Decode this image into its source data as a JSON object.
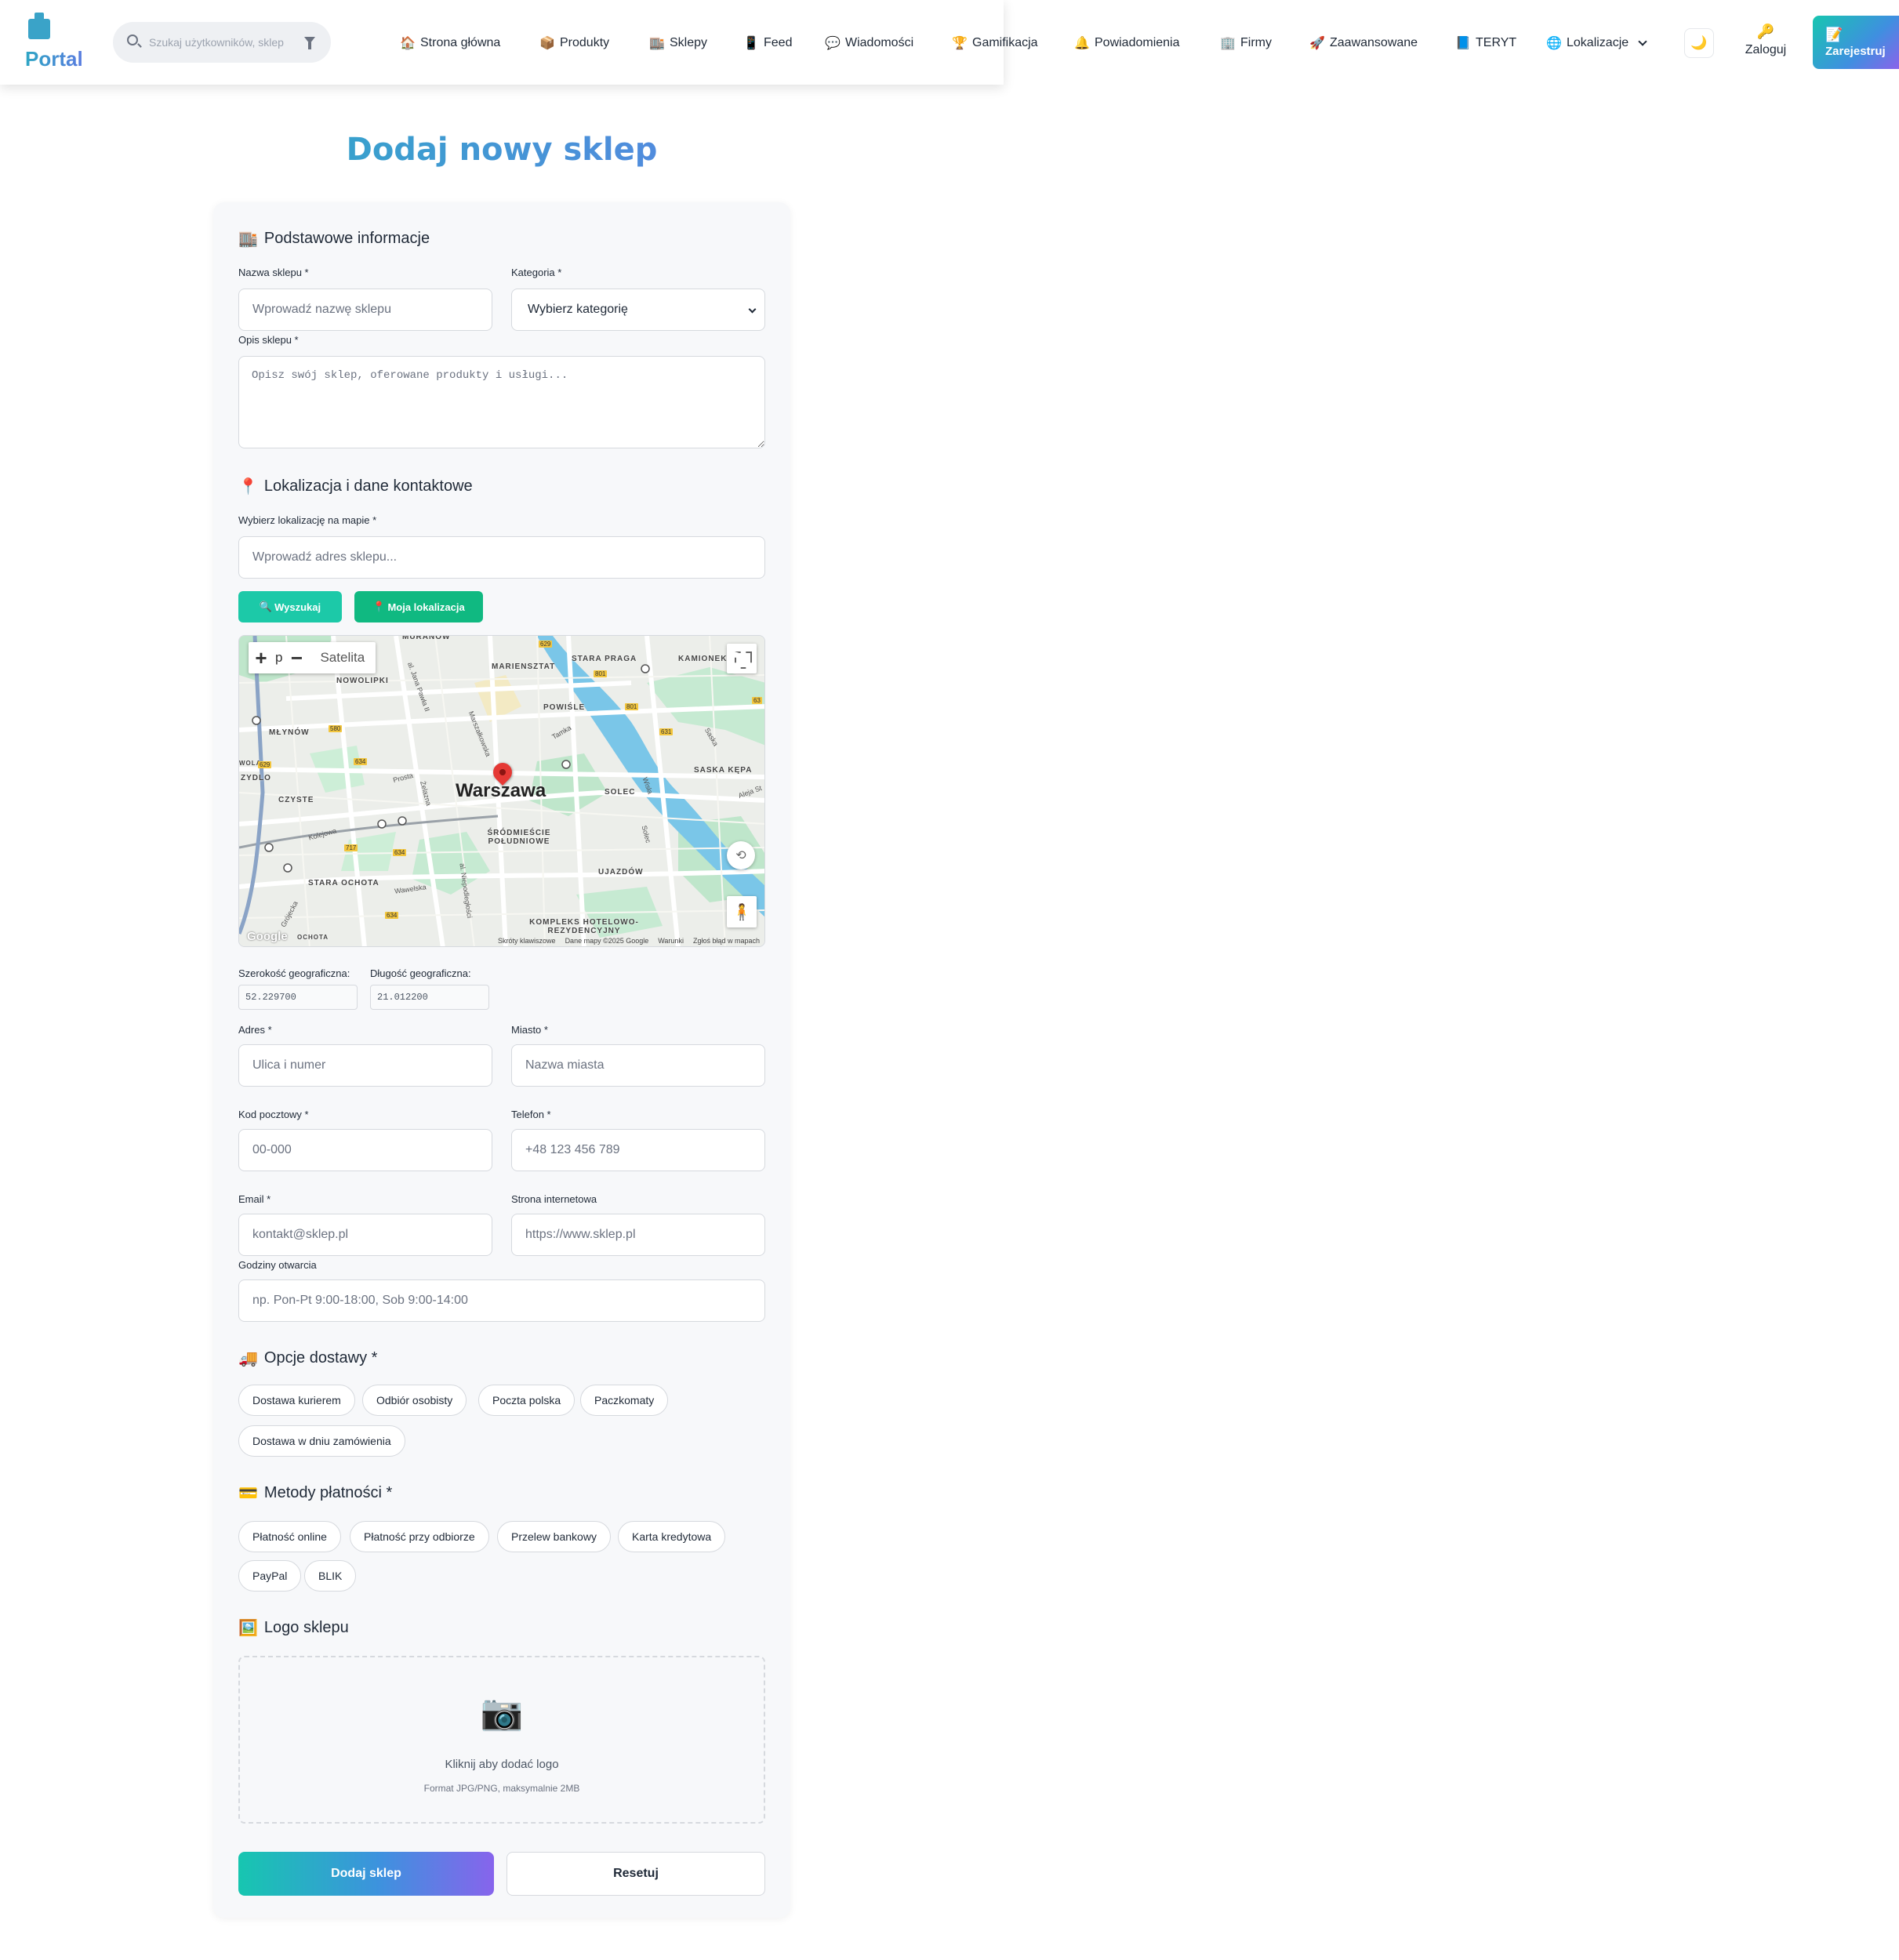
{
  "app": {
    "name": "Portal"
  },
  "search": {
    "placeholder": "Szukaj użytkowników, sklep"
  },
  "nav": {
    "items": [
      {
        "label": "Strona główna",
        "icon": "home-icon",
        "glyph": "🏠"
      },
      {
        "label": "Produkty",
        "icon": "box-icon",
        "glyph": "📦"
      },
      {
        "label": "Sklepy",
        "icon": "store-icon",
        "glyph": "🏬"
      },
      {
        "label": "Feed",
        "icon": "phone-icon",
        "glyph": "📱"
      },
      {
        "label": "Wiadomości",
        "icon": "chat-icon",
        "glyph": "💬"
      },
      {
        "label": "Gamifikacja",
        "icon": "trophy-icon",
        "glyph": "🏆"
      },
      {
        "label": "Powiadomienia",
        "icon": "bell-icon",
        "glyph": "🔔"
      },
      {
        "label": "Firmy",
        "icon": "building-icon",
        "glyph": "🏢"
      },
      {
        "label": "Zaawansowane",
        "icon": "rocket-icon",
        "glyph": "🚀"
      },
      {
        "label": "TERYT",
        "icon": "map-book-icon",
        "glyph": "📘"
      },
      {
        "label": "Lokalizacje",
        "icon": "globe-icon",
        "glyph": "🌐"
      }
    ],
    "theme_glyph": "🌙",
    "login_label": "Zaloguj",
    "login_glyph": "🔑",
    "register_label": "Zarejestruj",
    "register_glyph": "📝"
  },
  "page": {
    "title": "Dodaj nowy sklep"
  },
  "basic": {
    "title": "Podstawowe informacje",
    "glyph": "🏬",
    "name_label": "Nazwa sklepu *",
    "name_placeholder": "Wprowadź nazwę sklepu",
    "category_label": "Kategoria *",
    "category_value": "Wybierz kategorię",
    "desc_label": "Opis sklepu *",
    "desc_placeholder": "Opisz swój sklep, oferowane produkty i usługi..."
  },
  "location": {
    "title": "Lokalizacja i dane kontaktowe",
    "glyph": "📍",
    "map_label": "Wybierz lokalizację na mapie *",
    "address_placeholder": "Wprowadź adres sklepu...",
    "search_btn": "Wyszukaj",
    "search_glyph": "🔍",
    "myloc_btn": "Moja lokalizacja",
    "myloc_glyph": "📍",
    "map": {
      "type_label": "p",
      "satellite_label": "Satelita",
      "city": "Warszawa",
      "districts": [
        "MURANÓW",
        "MARIENSZTAT",
        "STARA PRAGA",
        "KAMIONEK",
        "NOWOLIPKI",
        "POWIŚLE",
        "MŁYNÓW",
        "WOLA",
        "ZYDLO",
        "CZYSTE",
        "SOLEC",
        "SASKA KĘPA",
        "ŚRÓDMIEŚCIE POŁUDNIOWE",
        "UJAZDÓW",
        "STARA OCHOTA",
        "KOMPLEKS HOTELOWO-REZYDENCYJNY",
        "OCHOTA"
      ],
      "streets": [
        "al. Jana Pawła II",
        "Marszałkowska",
        "Tamka",
        "Saska",
        "Prosta",
        "Żelazna",
        "Wisła",
        "Aleja St",
        "Kolejowa",
        "Wawelska",
        "al. Niepodległości",
        "Solec",
        "Grójecka"
      ],
      "road_numbers": [
        "629",
        "801",
        "631",
        "580",
        "634",
        "717",
        "629",
        "801",
        "634",
        "634",
        "63"
      ],
      "footer": [
        "Skróty klawiszowe",
        "Dane mapy ©2025 Google",
        "Warunki",
        "Zgłoś błąd w mapach"
      ],
      "google": "Google"
    },
    "lat_label": "Szerokość geograficzna:",
    "lat_value": "52.229700",
    "lng_label": "Długość geograficzna:",
    "lng_value": "21.012200",
    "address_label": "Adres *",
    "address_street_placeholder": "Ulica i numer",
    "city_label": "Miasto *",
    "city_placeholder": "Nazwa miasta",
    "zip_label": "Kod pocztowy *",
    "zip_placeholder": "00-000",
    "phone_label": "Telefon *",
    "phone_placeholder": "+48 123 456 789",
    "email_label": "Email *",
    "email_placeholder": "kontakt@sklep.pl",
    "www_label": "Strona internetowa",
    "www_placeholder": "https://www.sklep.pl",
    "hours_label": "Godziny otwarcia",
    "hours_placeholder": "np. Pon-Pt 9:00-18:00, Sob 9:00-14:00"
  },
  "delivery": {
    "title": "Opcje dostawy *",
    "glyph": "🚚",
    "options": [
      "Dostawa kurierem",
      "Odbiór osobisty",
      "Poczta polska",
      "Paczkomaty",
      "Dostawa w dniu zamówienia"
    ]
  },
  "payment": {
    "title": "Metody płatności *",
    "glyph": "💳",
    "options": [
      "Płatność online",
      "Płatność przy odbiorze",
      "Przelew bankowy",
      "Karta kredytowa",
      "PayPal",
      "BLIK"
    ]
  },
  "logo": {
    "title": "Logo sklepu",
    "glyph": "🖼️",
    "camera_glyph": "📷",
    "hint": "Kliknij aby dodać logo",
    "format": "Format JPG/PNG, maksymalnie 2MB"
  },
  "actions": {
    "submit": "Dodaj sklep",
    "reset": "Resetuj"
  },
  "colors": {
    "accent_teal": "#17c6b0",
    "accent_purple": "#8764ec",
    "green_btn": "#10b981",
    "card_bg": "#f7f8fa"
  }
}
